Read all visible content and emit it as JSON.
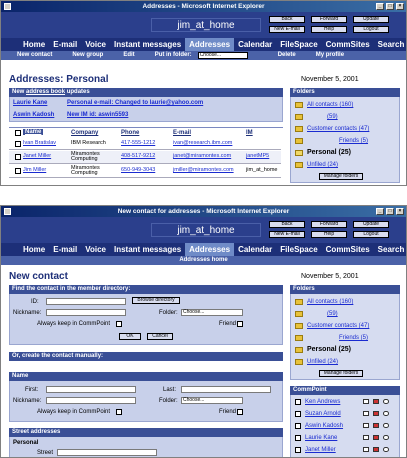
{
  "win1": {
    "title": "Addresses - Microsoft Internet Explorer",
    "user": "jim_at_home",
    "buttons": [
      "Back",
      "Forward",
      "Update",
      "New E-mail",
      "Help",
      "Logout"
    ],
    "nav": [
      "Home",
      "E-mail",
      "Voice",
      "Instant messages",
      "Addresses",
      "Calendar",
      "FileSpace",
      "CommSites",
      "Search"
    ],
    "nav_active": "Addresses",
    "subnav": [
      "New contact",
      "New group",
      "Edit",
      "Put in folder:"
    ],
    "subnav_right": [
      "Delete",
      "My profile"
    ],
    "folder_select": "Choose...",
    "page_title": "Addresses: Personal",
    "date": "November 5, 2001",
    "updates_header_pre": "New ",
    "updates_header_link": "address book",
    "updates_header_post": " updates",
    "updates": [
      {
        "name": "Laurie Kane",
        "msg": "Personal e-mail: Changed to laurie@yahoo.com"
      },
      {
        "name": "Aswin Kadosh",
        "msg": "New      IM id: aswin5593"
      }
    ],
    "table_headers": [
      "Name",
      "Company",
      "Phone",
      "E-mail",
      "IM"
    ],
    "rows": [
      {
        "name": "Ivan Bratislav",
        "company": "IBM Research",
        "phone": "417-555-1212",
        "email": "ivan@research.ibm.com",
        "im": ""
      },
      {
        "name": "Janet Miller",
        "company": "Miramontes Computing",
        "phone": "408-517-9212",
        "email": "janet@miramontes.com",
        "im": "janetMP5"
      },
      {
        "name": "Jim Miller",
        "company": "Miramontes Computing",
        "phone": "650-949-3043",
        "email": "jmiller@miramontes.com",
        "im": "jim_at_home"
      }
    ],
    "folders_title": "Folders",
    "folders": [
      "All contacts (160)",
      "(59)",
      "Customer contacts (47)",
      "Friends (5)",
      "Personal (25)",
      "Unfiled (24)"
    ],
    "manage_folders": "Manage folders"
  },
  "win2": {
    "title": "New contact for addresses - Microsoft Internet Explorer",
    "user": "jim_at_home",
    "buttons": [
      "Back",
      "Forward",
      "Update",
      "New E-mail",
      "Help",
      "Logout"
    ],
    "nav": [
      "Home",
      "E-mail",
      "Voice",
      "Instant messages",
      "Addresses",
      "Calendar",
      "FileSpace",
      "CommSites",
      "Search"
    ],
    "nav_active": "Addresses",
    "subnav": [
      "Addresses home"
    ],
    "page_title": "New contact",
    "date": "November 5, 2001",
    "find_header": "Find the contact in the                member directory:",
    "id_label": "ID:",
    "browse_btn": "Browse directory",
    "nickname_label": "Nickname:",
    "folder_label": "Folder:",
    "folder_choose": "Choose...",
    "keep_label": "Always keep in CommPoint",
    "friend_label": "Friend",
    "ok": "OK",
    "cancel": "Cancel",
    "manual_header": "Or, create the contact manually:",
    "name_header": "Name",
    "first_label": "First:",
    "last_label": "Last:",
    "street_header": "Street addresses",
    "personal_label": "Personal",
    "street_label": "Street",
    "folders_title": "Folders",
    "folders": [
      "All contacts (160)",
      "(59)",
      "Customer contacts (47)",
      "Friends (5)",
      "Personal (25)",
      "Unfiled (24)"
    ],
    "manage_folders": "Manage folders",
    "commpoint_title": "CommPoint",
    "commpoint": [
      "Ken Andrews",
      "Suzan Arnold",
      "Aswin Kadosh",
      "Laurie Kane",
      "Janet Miller"
    ]
  },
  "colors": {
    "banner": "#2b3f8c",
    "nav": "#1d2f78",
    "accent": "#6f8bc7",
    "link": "#1a2bd0"
  }
}
